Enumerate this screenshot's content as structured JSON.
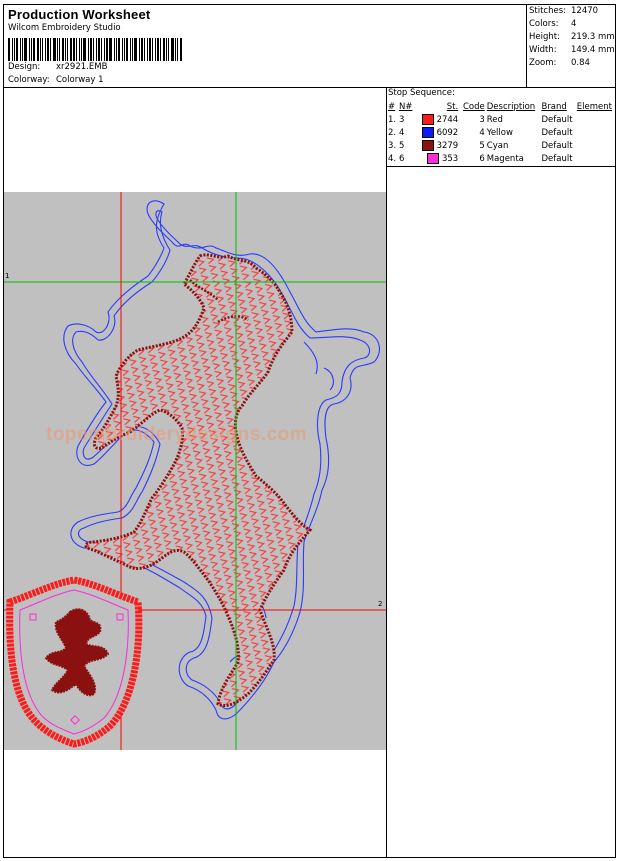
{
  "header": {
    "title": "Production Worksheet",
    "company": "Wilcom Embroidery Studio",
    "design_label": "Design:",
    "design_value": "xr2921.EMB",
    "colorway_label": "Colorway:",
    "colorway_value": "Colorway 1"
  },
  "stats": [
    {
      "label": "Stitches:",
      "value": "12470"
    },
    {
      "label": "Colors:",
      "value": "4"
    },
    {
      "label": "Height:",
      "value": "219.3 mm"
    },
    {
      "label": "Width:",
      "value": "149.4 mm"
    },
    {
      "label": "Zoom:",
      "value": "0.84"
    }
  ],
  "stop_sequence": {
    "title": "Stop Sequence:",
    "columns": [
      "#",
      "N#",
      "St.",
      "Code",
      "Description",
      "Brand",
      "Element"
    ],
    "rows": [
      {
        "num": "1.",
        "n": "3",
        "color": "#ff1a1a",
        "stitches": "2744",
        "code": "3",
        "description": "Red",
        "brand": "Default",
        "element": ""
      },
      {
        "num": "2.",
        "n": "4",
        "color": "#0a1aff",
        "stitches": "6092",
        "code": "4",
        "description": "Yellow",
        "brand": "Default",
        "element": ""
      },
      {
        "num": "3.",
        "n": "5",
        "color": "#8b1010",
        "stitches": "3279",
        "code": "5",
        "description": "Cyan",
        "brand": "Default",
        "element": ""
      },
      {
        "num": "4.",
        "n": "6",
        "color": "#ff2ad8",
        "stitches": "353",
        "code": "6",
        "description": "Magenta",
        "brand": "Default",
        "element": ""
      }
    ]
  },
  "design": {
    "background": "#c0c0c0",
    "guide_red": "#ff0000",
    "guide_green": "#00c000",
    "marker_1": "1",
    "marker_2": "2",
    "watermark": "topembroiderydesigns.com",
    "outline_color": "#2a3aff",
    "fill_color": "#8b1010",
    "stitch_color": "#ff3030"
  }
}
